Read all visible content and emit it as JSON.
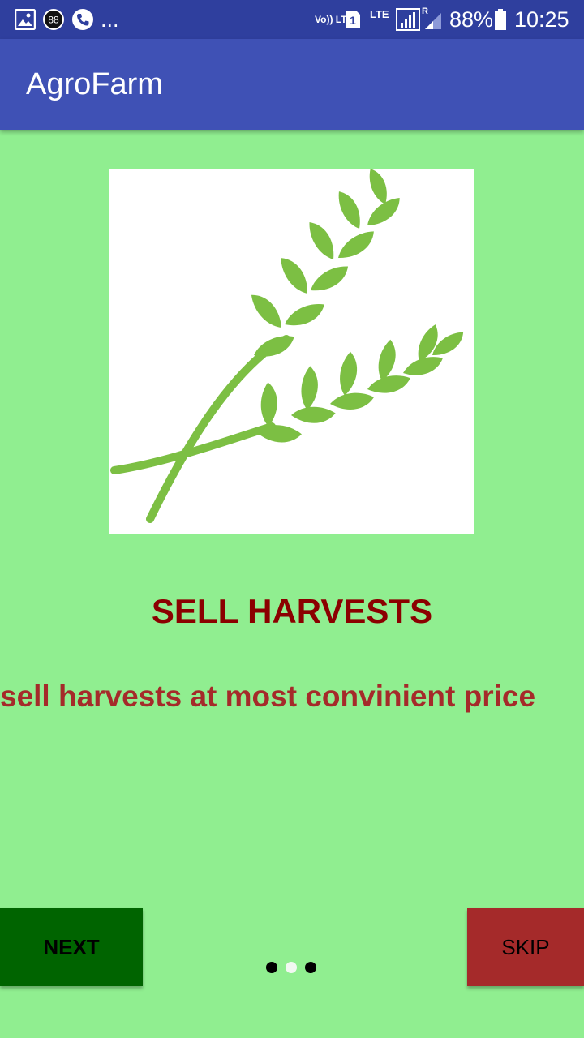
{
  "status_bar": {
    "notification_badge": "88",
    "more": "...",
    "volte": "Vo)) LTE",
    "sim_slot": "1",
    "network": "LTE",
    "roaming": "R",
    "battery": "88%",
    "time": "10:25"
  },
  "app_bar": {
    "title": "AgroFarm"
  },
  "slide": {
    "image_icon": "wheat-icon",
    "title": "SELL HARVESTS",
    "description": "sell harvests at most convinient price"
  },
  "pager": {
    "count": 3,
    "active_index": 1
  },
  "buttons": {
    "next_label": "NEXT",
    "skip_label": "SKIP"
  },
  "colors": {
    "background": "#90ee90",
    "app_bar": "#3f51b5",
    "status_bar": "#2f3f9e",
    "title": "#8b0000",
    "description": "#a52a2a",
    "next_button": "#006400",
    "skip_button": "#a52a2a",
    "wheat": "#7cbf43"
  }
}
